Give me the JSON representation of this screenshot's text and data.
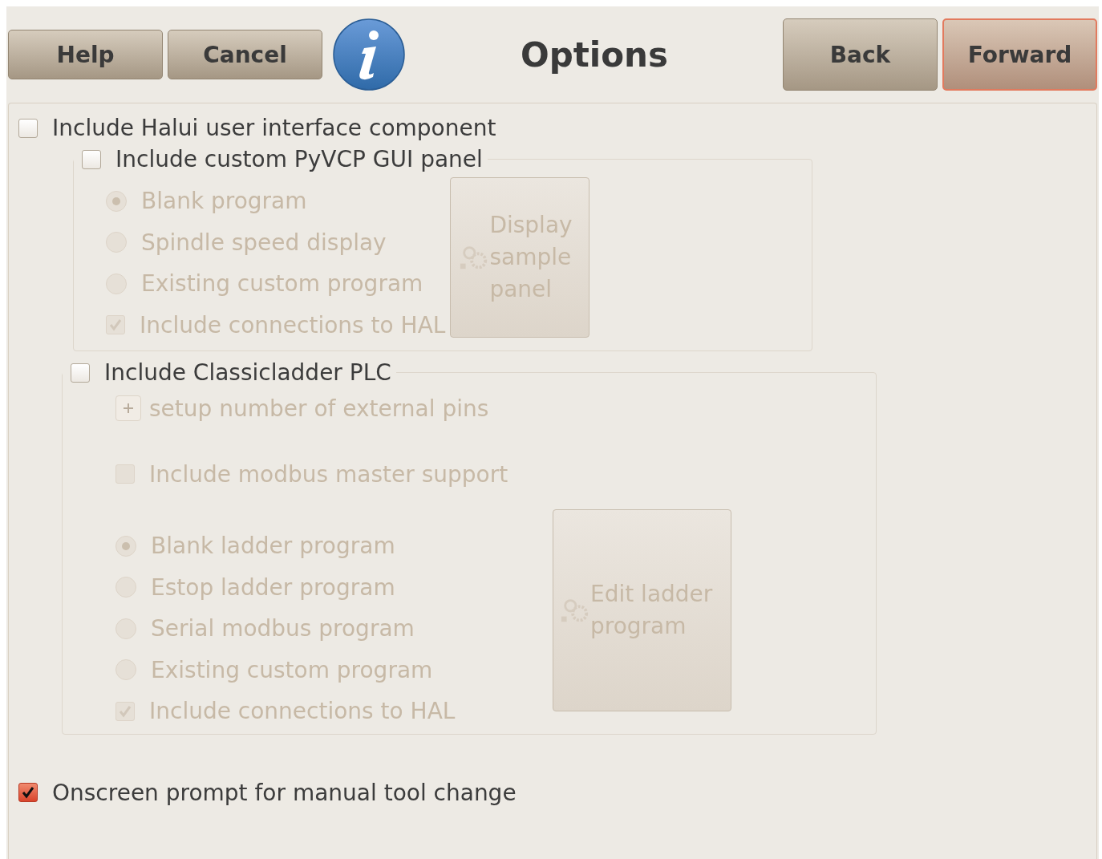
{
  "header": {
    "left_buttons": [
      {
        "label": "Help"
      },
      {
        "label": "Cancel"
      }
    ],
    "title": "Options",
    "right_buttons": [
      {
        "label": "Back",
        "focused": false
      },
      {
        "label": "Forward",
        "focused": true
      }
    ]
  },
  "halui": {
    "label": "Include Halui user interface component",
    "checked": false
  },
  "pyvcp": {
    "label": "Include custom PyVCP GUI panel",
    "checked": false,
    "disabled": true,
    "options": [
      {
        "label": "Blank program",
        "selected": true
      },
      {
        "label": "Spindle speed display",
        "selected": false
      },
      {
        "label": "Existing custom program",
        "selected": false
      }
    ],
    "connect": {
      "label": "Include connections to HAL",
      "checked": true
    },
    "button": "Display sample panel"
  },
  "classicladder": {
    "label": "Include Classicladder PLC",
    "checked": false,
    "disabled": true,
    "expander": {
      "label": "setup number of external pins",
      "expanded": false
    },
    "modbus": {
      "label": "Include modbus master support",
      "checked": false
    },
    "options": [
      {
        "label": "Blank ladder program",
        "selected": true
      },
      {
        "label": "Estop ladder program",
        "selected": false
      },
      {
        "label": "Serial modbus program",
        "selected": false
      },
      {
        "label": "Existing custom program",
        "selected": false
      }
    ],
    "connect": {
      "label": "Include connections to HAL",
      "checked": true
    },
    "button": "Edit ladder program"
  },
  "tool_change": {
    "label": "Onscreen prompt for manual tool change",
    "checked": true
  }
}
